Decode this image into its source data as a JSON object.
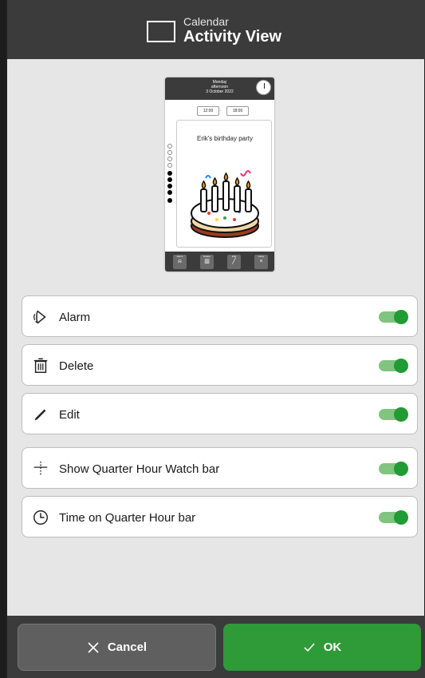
{
  "header": {
    "subtitle": "Calendar",
    "title": "Activity View",
    "icon": "rectangle-icon"
  },
  "preview": {
    "day": "Monday",
    "period": "afternoon",
    "date": "3 October 2022",
    "start_time": "12:00",
    "end_time": "18:00",
    "time_separator": "-",
    "activity_title": "Erik's birthday party",
    "image": "birthday-cake-image",
    "buttons": [
      {
        "label": "Alarm",
        "icon": "alarm-icon"
      },
      {
        "label": "Delete",
        "icon": "trash-icon"
      },
      {
        "label": "Edit",
        "icon": "pencil-icon"
      },
      {
        "label": "Close",
        "icon": "close-icon"
      }
    ]
  },
  "settings": [
    {
      "label": "Alarm",
      "icon": "alarm-icon",
      "enabled": true
    },
    {
      "label": "Delete",
      "icon": "trash-icon",
      "enabled": true
    },
    {
      "label": "Edit",
      "icon": "pencil-icon",
      "enabled": true
    },
    {
      "label": "Show Quarter Hour Watch bar",
      "icon": "quarter-hour-bar-icon",
      "enabled": true
    },
    {
      "label": "Time on Quarter Hour bar",
      "icon": "clock-icon",
      "enabled": true
    }
  ],
  "footer": {
    "cancel_label": "Cancel",
    "ok_label": "OK"
  },
  "colors": {
    "header_bg": "#3b3b3b",
    "page_bg": "#e6e6e6",
    "accent_green": "#219b34",
    "toggle_track": "#7fc47f",
    "ok_button": "#2e9a38",
    "cancel_button": "#5f5f5f"
  }
}
